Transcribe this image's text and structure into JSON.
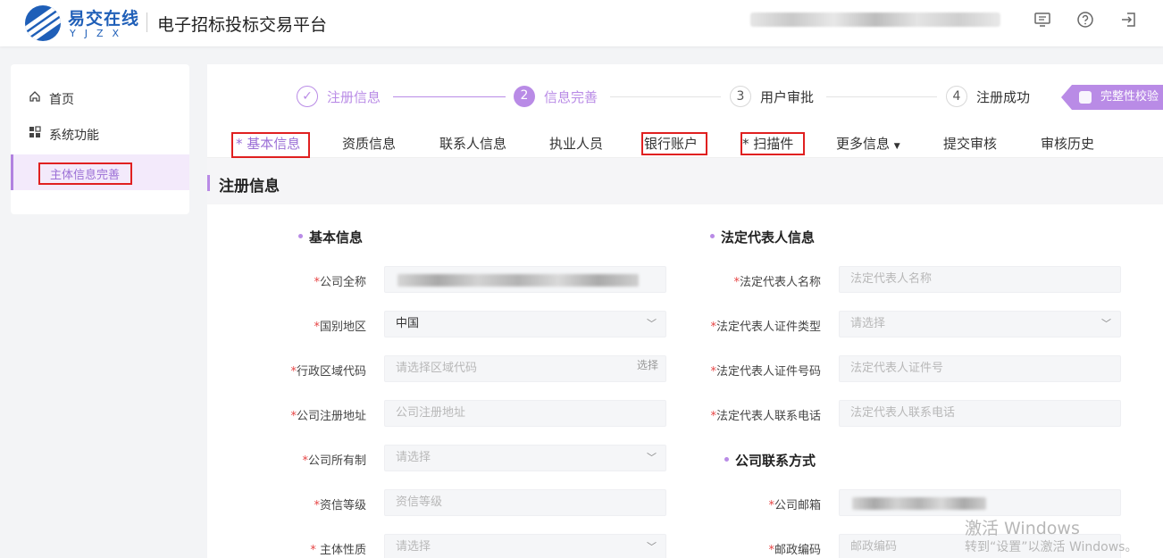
{
  "header": {
    "logo_cn": "易交在线",
    "logo_en": "YJZX",
    "app_title": "电子招标投标交易平台",
    "icons": [
      "monitor-icon",
      "help-icon",
      "logout-icon"
    ]
  },
  "sidebar": {
    "items": [
      {
        "label": "首页",
        "icon": "home-icon"
      },
      {
        "label": "系统功能",
        "icon": "apps-icon"
      }
    ],
    "sub_item": "主体信息完善"
  },
  "steps": [
    {
      "num": "✓",
      "label": "注册信息",
      "state": "done"
    },
    {
      "num": "2",
      "label": "信息完善",
      "state": "active"
    },
    {
      "num": "3",
      "label": "用户审批",
      "state": "todo"
    },
    {
      "num": "4",
      "label": "注册成功",
      "state": "todo"
    }
  ],
  "check_button": "完整性校验",
  "tabs": [
    "* 基本信息",
    "资质信息",
    "联系人信息",
    "执业人员",
    "银行账户",
    "* 扫描件",
    "更多信息",
    "提交审核",
    "审核历史"
  ],
  "section_title": "注册信息",
  "left_group": {
    "title": "基本信息",
    "fields": [
      {
        "label": "公司全称",
        "value": ""
      },
      {
        "label": "国别地区",
        "value": "中国"
      },
      {
        "label": "行政区域代码",
        "placeholder": "请选择区域代码",
        "action": "选择"
      },
      {
        "label": "公司注册地址",
        "placeholder": "公司注册地址"
      },
      {
        "label": "公司所有制",
        "placeholder": "请选择"
      },
      {
        "label": "资信等级",
        "placeholder": "资信等级"
      },
      {
        "label": " 主体性质",
        "placeholder": "请选择"
      }
    ]
  },
  "right_group": {
    "title": "法定代表人信息",
    "fields": [
      {
        "label": "法定代表人名称",
        "placeholder": "法定代表人名称"
      },
      {
        "label": "法定代表人证件类型",
        "placeholder": "请选择"
      },
      {
        "label": "法定代表人证件号码",
        "placeholder": "法定代表人证件号"
      },
      {
        "label": "法定代表人联系电话",
        "placeholder": "法定代表人联系电话"
      }
    ]
  },
  "contact_group": {
    "title": "公司联系方式",
    "fields": [
      {
        "label": "公司邮箱",
        "value": ""
      },
      {
        "label": "邮政编码",
        "placeholder": "邮政编码"
      }
    ]
  },
  "watermark": {
    "line1": "激活 Windows",
    "line2": "转到“设置”以激活 Windows。"
  },
  "colors": {
    "accent": "#b98be6",
    "highlight_box": "#e02020",
    "brand": "#1f5fb8"
  }
}
